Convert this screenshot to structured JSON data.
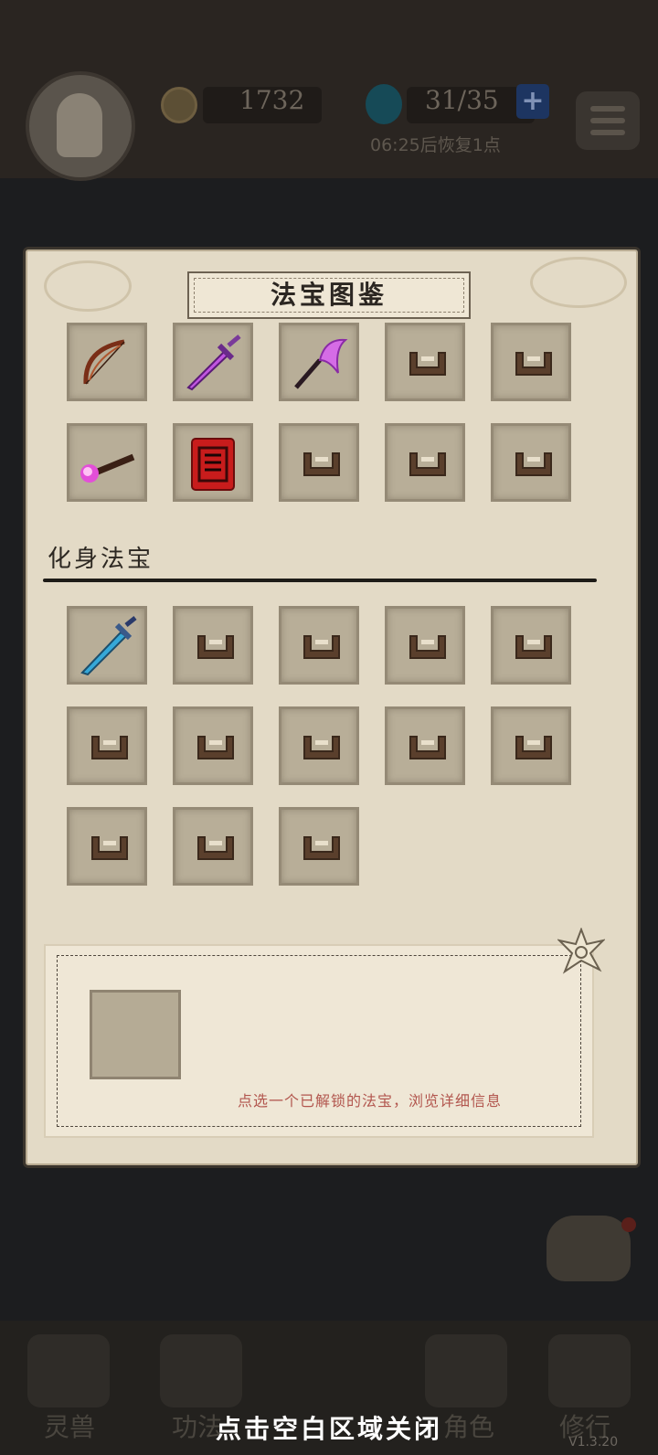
{
  "hud": {
    "coins": "1732",
    "stamina": "31/35",
    "plus_label": "+",
    "recover_timer": "06:25后恢复1点"
  },
  "nav": {
    "items": [
      {
        "label": "灵兽"
      },
      {
        "label": "功法"
      },
      {
        "label": "角色"
      },
      {
        "label": "修行"
      }
    ]
  },
  "version": "V1.3.20",
  "close_hint": "点击空白区域关闭",
  "modal": {
    "title": "法宝图鉴",
    "artifacts": [
      {
        "state": "unlocked",
        "icon": "bow-icon"
      },
      {
        "state": "unlocked",
        "icon": "purple-sword-icon"
      },
      {
        "state": "unlocked",
        "icon": "purple-scythe-icon"
      },
      {
        "state": "locked",
        "icon": "lock-icon"
      },
      {
        "state": "locked",
        "icon": "lock-icon"
      },
      {
        "state": "unlocked",
        "icon": "flame-brush-icon"
      },
      {
        "state": "unlocked",
        "icon": "red-scroll-icon"
      },
      {
        "state": "locked",
        "icon": "lock-icon"
      },
      {
        "state": "locked",
        "icon": "lock-icon"
      },
      {
        "state": "locked",
        "icon": "lock-icon"
      }
    ],
    "avatar_section_label": "化身法宝",
    "avatar_artifacts": [
      {
        "state": "unlocked",
        "icon": "ice-sword-icon"
      },
      {
        "state": "locked",
        "icon": "lock-icon"
      },
      {
        "state": "locked",
        "icon": "lock-icon"
      },
      {
        "state": "locked",
        "icon": "lock-icon"
      },
      {
        "state": "locked",
        "icon": "lock-icon"
      },
      {
        "state": "locked",
        "icon": "lock-icon"
      },
      {
        "state": "locked",
        "icon": "lock-icon"
      },
      {
        "state": "locked",
        "icon": "lock-icon"
      },
      {
        "state": "locked",
        "icon": "lock-icon"
      },
      {
        "state": "locked",
        "icon": "lock-icon"
      },
      {
        "state": "locked",
        "icon": "lock-icon"
      },
      {
        "state": "locked",
        "icon": "lock-icon"
      },
      {
        "state": "locked",
        "icon": "lock-icon"
      }
    ],
    "info_hint": "点选一个已解锁的法宝，浏览详细信息"
  },
  "colors": {
    "panel_bg": "#e3dac6",
    "slot_bg": "#b8ae98",
    "hint_text": "#b2564e",
    "lock": "#5a3f2c"
  }
}
